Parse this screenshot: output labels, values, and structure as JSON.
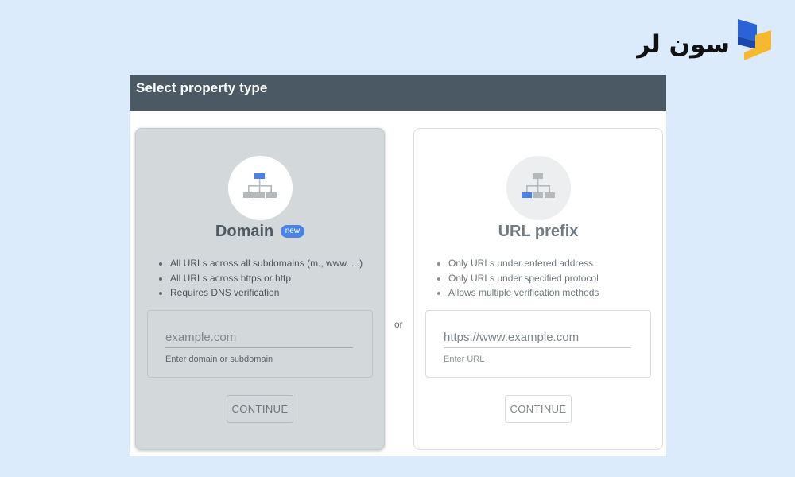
{
  "brand": {
    "name": "سون لرن",
    "colors": {
      "text": "#111111",
      "blue": "#2a63d8",
      "yellow": "#f5b82e"
    }
  },
  "dialog": {
    "title": "Select property type",
    "or_label": "or"
  },
  "cards": {
    "domain": {
      "icon": "sitemap-icon",
      "title": "Domain",
      "badge": "new",
      "features": [
        "All URLs across all subdomains (m., www. ...)",
        "All URLs across https or http",
        "Requires DNS verification"
      ],
      "input_placeholder": "example.com",
      "input_value": "",
      "hint": "Enter domain or subdomain",
      "button": "CONTINUE"
    },
    "url": {
      "icon": "sitemap-icon",
      "title": "URL prefix",
      "features": [
        "Only URLs under entered address",
        "Only URLs under specified protocol",
        "Allows multiple verification methods"
      ],
      "input_placeholder": "https://www.example.com",
      "input_value": "",
      "hint": "Enter URL",
      "button": "CONTINUE"
    }
  },
  "colors": {
    "page_bg": "#dcebfb",
    "header_bg": "#4a5963",
    "accent_blue": "#4a82e8"
  }
}
